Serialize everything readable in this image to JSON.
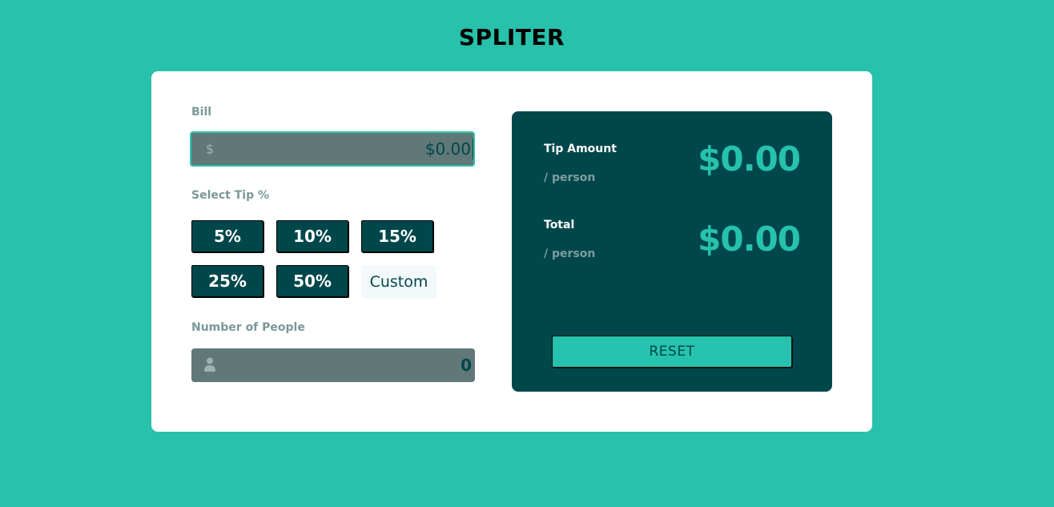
{
  "title": "SPLITER",
  "bill": {
    "label": "Bill",
    "prefix": "$",
    "value": "$0.00"
  },
  "tip": {
    "label": "Select Tip %",
    "options": [
      "5%",
      "10%",
      "15%",
      "25%",
      "50%"
    ],
    "custom_label": "Custom"
  },
  "people": {
    "label": "Number of People",
    "icon": "person-icon",
    "value": "0"
  },
  "results": {
    "tip_amount_label": "Tip Amount",
    "tip_amount_sub": "/ person",
    "tip_amount_value": "$0.00",
    "total_label": "Total",
    "total_sub": "/ person",
    "total_value": "$0.00",
    "reset_label": "RESET"
  },
  "colors": {
    "background": "#28c1ab",
    "panel": "#00474b",
    "accent": "#26c2ad",
    "input_bg": "#617878"
  }
}
